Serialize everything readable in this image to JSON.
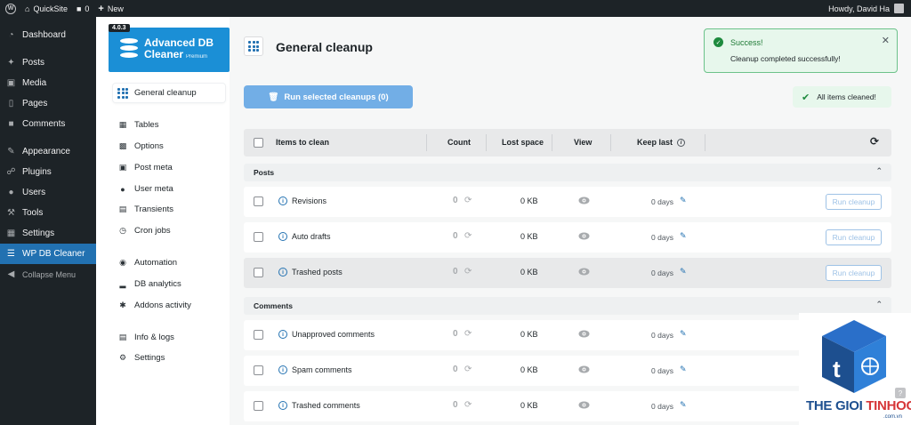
{
  "adminbar": {
    "site_name": "QuickSite",
    "comments_count": "0",
    "new_label": "New",
    "howdy": "Howdy, David Ha"
  },
  "admin_menu": {
    "items": [
      {
        "label": "Dashboard",
        "icon": "dashboard-icon"
      },
      {
        "label": "Posts",
        "icon": "pin-icon"
      },
      {
        "label": "Media",
        "icon": "media-icon"
      },
      {
        "label": "Pages",
        "icon": "pages-icon"
      },
      {
        "label": "Comments",
        "icon": "comment-icon"
      },
      {
        "label": "Appearance",
        "icon": "brush-icon"
      },
      {
        "label": "Plugins",
        "icon": "plug-icon"
      },
      {
        "label": "Users",
        "icon": "user-icon"
      },
      {
        "label": "Tools",
        "icon": "wrench-icon"
      },
      {
        "label": "Settings",
        "icon": "settings-icon"
      },
      {
        "label": "WP DB Cleaner",
        "icon": "database-icon"
      }
    ],
    "collapse_label": "Collapse Menu"
  },
  "plugin": {
    "version": "4.0.3",
    "title_line1": "Advanced DB",
    "title_line2": "Cleaner",
    "edition": "Premium",
    "nav": [
      {
        "label": "General cleanup",
        "icon": "grid-icon"
      },
      {
        "label": "Tables",
        "icon": "table-icon"
      },
      {
        "label": "Options",
        "icon": "options-icon"
      },
      {
        "label": "Post meta",
        "icon": "post-meta-icon"
      },
      {
        "label": "User meta",
        "icon": "user-meta-icon"
      },
      {
        "label": "Transients",
        "icon": "transients-icon"
      },
      {
        "label": "Cron jobs",
        "icon": "clock-icon"
      },
      {
        "label": "Automation",
        "icon": "automation-icon"
      },
      {
        "label": "DB analytics",
        "icon": "analytics-icon"
      },
      {
        "label": "Addons activity",
        "icon": "puzzle-icon"
      },
      {
        "label": "Info & logs",
        "icon": "info-logs-icon"
      },
      {
        "label": "Settings",
        "icon": "gear-icon"
      }
    ]
  },
  "main": {
    "page_title": "General cleanup",
    "run_button": "Run selected cleanups (0)",
    "all_cleaned": "All items cleaned!",
    "toast": {
      "title": "Success!",
      "message": "Cleanup completed successfully!"
    },
    "columns": {
      "items": "Items to clean",
      "count": "Count",
      "lost_space": "Lost space",
      "view": "View",
      "keep_last": "Keep last"
    },
    "sections": [
      {
        "title": "Posts",
        "rows": [
          {
            "name": "Revisions",
            "count": "0",
            "space": "0 KB",
            "keep": "0 days",
            "action": "Run cleanup"
          },
          {
            "name": "Auto drafts",
            "count": "0",
            "space": "0 KB",
            "keep": "0 days",
            "action": "Run cleanup"
          },
          {
            "name": "Trashed posts",
            "count": "0",
            "space": "0 KB",
            "keep": "0 days",
            "action": "Run cleanup"
          }
        ]
      },
      {
        "title": "Comments",
        "rows": [
          {
            "name": "Unapproved comments",
            "count": "0",
            "space": "0 KB",
            "keep": "0 days"
          },
          {
            "name": "Spam comments",
            "count": "0",
            "space": "0 KB",
            "keep": "0 days"
          },
          {
            "name": "Trashed comments",
            "count": "0",
            "space": "0 KB",
            "keep": "0 days"
          }
        ]
      }
    ]
  },
  "watermark": {
    "text_left": "THE GIOI ",
    "text_right": "TINHOC",
    "sub": ".com.vn"
  },
  "colors": {
    "admin_dark": "#1d2327",
    "wp_blue": "#2271b1",
    "brand_blue": "#1b8fd6",
    "success_green": "#1e8a3e"
  }
}
